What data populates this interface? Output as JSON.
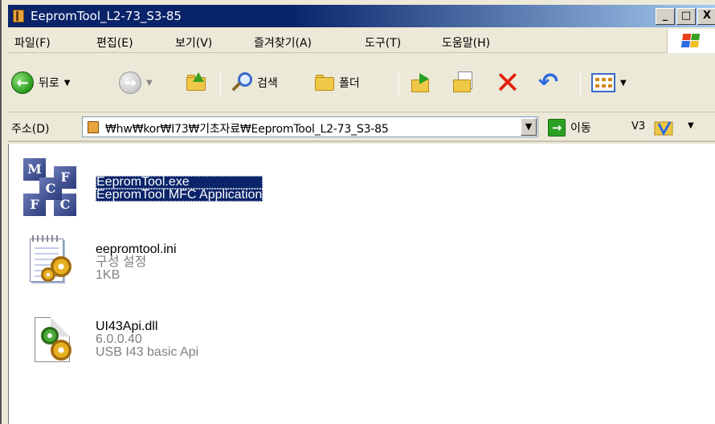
{
  "window": {
    "title": "EepromTool_L2-73_S3-85",
    "buttons": {
      "minimize": "_",
      "maximize": "□",
      "close": "X"
    }
  },
  "menubar": {
    "items": [
      "파일(F)",
      "편집(E)",
      "보기(V)",
      "즐겨찾기(A)",
      "도구(T)",
      "도움말(H)"
    ]
  },
  "toolbar": {
    "back_label": "뒤로",
    "search_label": "검색",
    "folders_label": "폴더"
  },
  "addressbar": {
    "label": "주소(D)",
    "path": "₩hw₩kor₩I73₩기초자료₩EepromTool_L2-73_S3-85",
    "go_label": "이동",
    "v3_label": "V3"
  },
  "files": [
    {
      "name": "EepromTool.exe",
      "line2": "EepromTool MFC Application",
      "line3": "",
      "selected": true
    },
    {
      "name": "eepromtool.ini",
      "line2": "구성 설정",
      "line3": "1KB",
      "selected": false
    },
    {
      "name": "UI43Api.dll",
      "line2": "6.0.0.40",
      "line3": "USB I43 basic Api",
      "selected": false
    }
  ],
  "colors": {
    "title_bar": "#0a246a",
    "selection": "#0a246a",
    "secondary_text": "#808080"
  }
}
